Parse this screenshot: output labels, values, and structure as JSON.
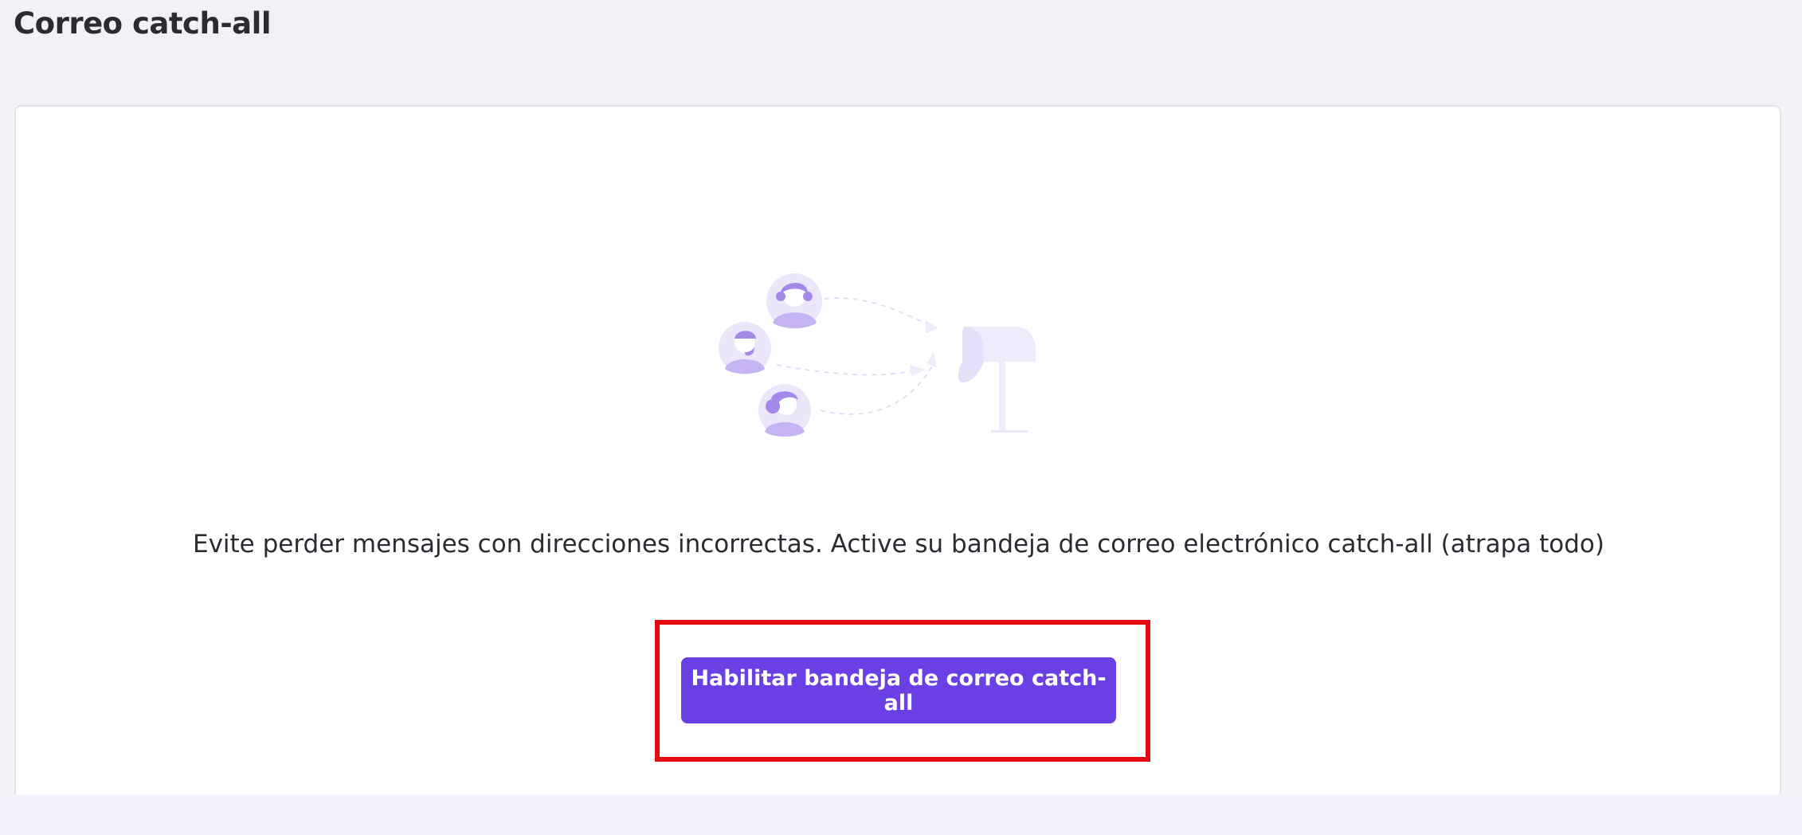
{
  "page": {
    "title": "Correo catch-all"
  },
  "empty_state": {
    "illustration_icon": "catch-all-mailbox-illustration",
    "description": "Evite perder mensajes con direcciones incorrectas. Active su bandeja de correo electrónico catch-all (atrapa todo)",
    "enable_button_label": "Habilitar bandeja de correo catch-all"
  },
  "colors": {
    "accent": "#6a40e5",
    "highlight": "#e50914",
    "illustration_light": "#ece6fb",
    "illustration_mid": "#c5b3f3",
    "illustration_dark": "#a489ea"
  }
}
